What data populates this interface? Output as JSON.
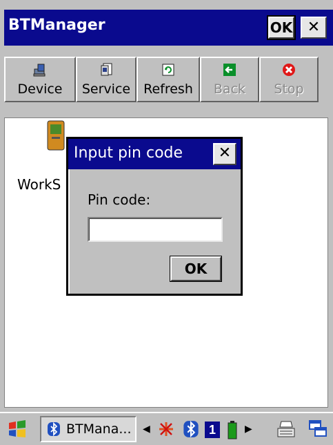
{
  "window": {
    "title": "BTManager",
    "ok_label": "OK",
    "close_label": "✕"
  },
  "toolbar": {
    "buttons": [
      {
        "label": "Device",
        "icon": "device-icon",
        "enabled": true
      },
      {
        "label": "Service",
        "icon": "service-icon",
        "enabled": true
      },
      {
        "label": "Refresh",
        "icon": "refresh-icon",
        "enabled": true
      },
      {
        "label": "Back",
        "icon": "back-arrow-icon",
        "enabled": false
      },
      {
        "label": "Stop",
        "icon": "stop-icon",
        "enabled": false
      }
    ]
  },
  "content": {
    "device_label": "WorkS"
  },
  "dialog": {
    "title": "Input pin code",
    "close_label": "✕",
    "pin_label": "Pin code:",
    "pin_value": "",
    "ok_label": "OK"
  },
  "taskbar": {
    "task_label": "BTMana...",
    "tray_number": "1",
    "colors": {
      "titlebar": "#0a0a8e",
      "back_icon": "#0a8f2a",
      "stop_icon": "#e01818"
    }
  }
}
